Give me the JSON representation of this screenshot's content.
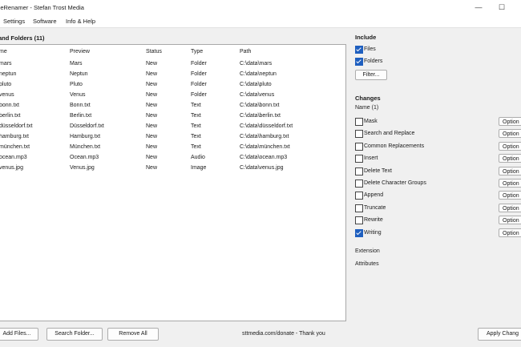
{
  "window": {
    "title": "ileRenamer - Stefan Trost Media",
    "minimize": "—",
    "maximize": "☐"
  },
  "menu": [
    "Settings",
    "Software",
    "Info & Help"
  ],
  "list": {
    "title": "and Folders (11)",
    "columns": [
      "me",
      "Preview",
      "Status",
      "Type",
      "Path"
    ],
    "rows": [
      [
        "mars",
        "Mars",
        "New",
        "Folder",
        "C:\\data\\mars"
      ],
      [
        "neptun",
        "Neptun",
        "New",
        "Folder",
        "C:\\data\\neptun"
      ],
      [
        "pluto",
        "Pluto",
        "New",
        "Folder",
        "C:\\data\\pluto"
      ],
      [
        "venus",
        "Venus",
        "New",
        "Folder",
        "C:\\data\\venus"
      ],
      [
        "bonn.txt",
        "Bonn.txt",
        "New",
        "Text",
        "C:\\data\\bonn.txt"
      ],
      [
        "berlin.txt",
        "Berlin.txt",
        "New",
        "Text",
        "C:\\data\\berlin.txt"
      ],
      [
        "düsseldorf.txt",
        "Düsseldorf.txt",
        "New",
        "Text",
        "C:\\data\\düsseldorf.txt"
      ],
      [
        "hamburg.txt",
        "Hamburg.txt",
        "New",
        "Text",
        "C:\\data\\hamburg.txt"
      ],
      [
        "münchen.txt",
        "München.txt",
        "New",
        "Text",
        "C:\\data\\münchen.txt"
      ],
      [
        "ocean.mp3",
        "Ocean.mp3",
        "New",
        "Audio",
        "C:\\data\\ocean.mp3"
      ],
      [
        "venus.jpg",
        "Venus.jpg",
        "New",
        "Image",
        "C:\\data\\venus.jpg"
      ]
    ]
  },
  "bottom": {
    "add_files": "Add Files...",
    "search_folder": "Search Folder...",
    "remove_all": "Remove All",
    "status": "sttmedia.com/donate - Thank you",
    "apply": "Apply Chang"
  },
  "include": {
    "title": "Include",
    "items": [
      {
        "label": "Files",
        "checked": true
      },
      {
        "label": "Folders",
        "checked": true
      }
    ],
    "filter": "Filter..."
  },
  "changes": {
    "title": "Changes",
    "name_header": "Name (1)",
    "items": [
      {
        "label": "Mask",
        "checked": false
      },
      {
        "label": "Search and Replace",
        "checked": false
      },
      {
        "label": "Common Replacements",
        "checked": false
      },
      {
        "label": "Insert",
        "checked": false
      },
      {
        "label": "Delete Text",
        "checked": false
      },
      {
        "label": "Delete Character Groups",
        "checked": false
      },
      {
        "label": "Append",
        "checked": false
      },
      {
        "label": "Truncate",
        "checked": false
      },
      {
        "label": "Rewrite",
        "checked": false
      },
      {
        "label": "Writing",
        "checked": true
      }
    ],
    "options_label": "Option",
    "extension": "Extension",
    "attributes": "Attributes"
  },
  "colors": {
    "checkbox_on": "#1f5fbf",
    "window_bg": "#f0f0f0",
    "list_bg": "#ffffff"
  }
}
